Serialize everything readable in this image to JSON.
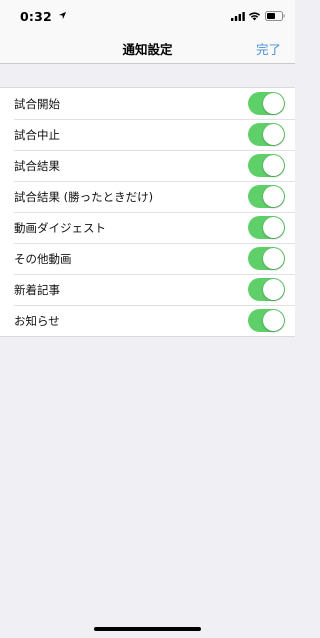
{
  "status_bar": {
    "time": "0:32",
    "icons": [
      "location-arrow-icon",
      "signal-icon",
      "wifi-icon",
      "battery-icon"
    ]
  },
  "nav": {
    "title": "通知設定",
    "done_label": "完了"
  },
  "colors": {
    "background": "#efeff4",
    "toggle_on": "#5fd069",
    "accent": "#4a90d9"
  },
  "settings": {
    "items": [
      {
        "label": "試合開始",
        "enabled": true
      },
      {
        "label": "試合中止",
        "enabled": true
      },
      {
        "label": "試合結果",
        "enabled": true
      },
      {
        "label": "試合結果 (勝ったときだけ)",
        "enabled": true
      },
      {
        "label": "動画ダイジェスト",
        "enabled": true
      },
      {
        "label": "その他動画",
        "enabled": true
      },
      {
        "label": "新着記事",
        "enabled": true
      },
      {
        "label": "お知らせ",
        "enabled": true
      }
    ]
  }
}
